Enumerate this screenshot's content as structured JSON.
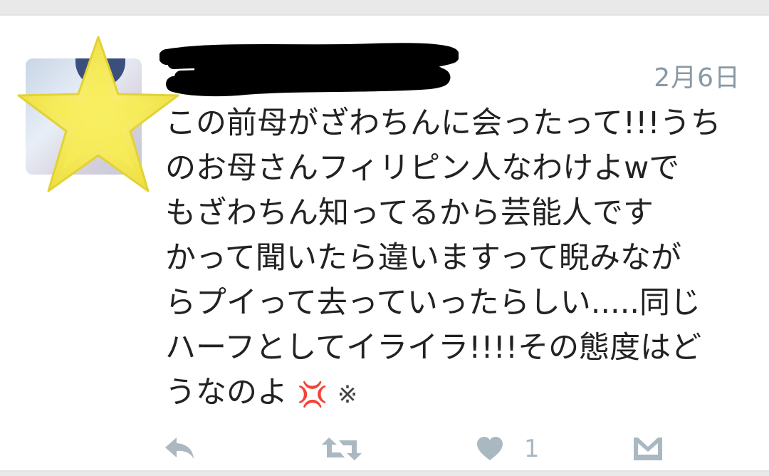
{
  "tweet": {
    "date": "2月6日",
    "text_lines": [
      "この前母がざわちんに会ったって!!!うち",
      "のお母さんフィリピン人なわけよwで",
      "もざわちん知ってるから芸能人です",
      "かって聞いたら違いますって睨みなが",
      "らプイって去っていったらしい.....同じ",
      "ハーフとしてイライラ!!!!その態度はど",
      "うなのよ"
    ],
    "emoji_anger": "💢",
    "emoji_mark": "※",
    "like_count": "1"
  },
  "icons": {
    "avatar_overlay": "star-icon",
    "name_redaction": "redaction-scribble",
    "reply": "reply-icon",
    "retweet": "retweet-icon",
    "like": "heart-icon",
    "message": "direct-message-icon"
  },
  "colors": {
    "text": "#222222",
    "meta": "#8899a6",
    "action": "#aab8c2",
    "star_fill": "#f5e94a",
    "star_stroke": "#e8d83a",
    "anger": "#e53935"
  }
}
